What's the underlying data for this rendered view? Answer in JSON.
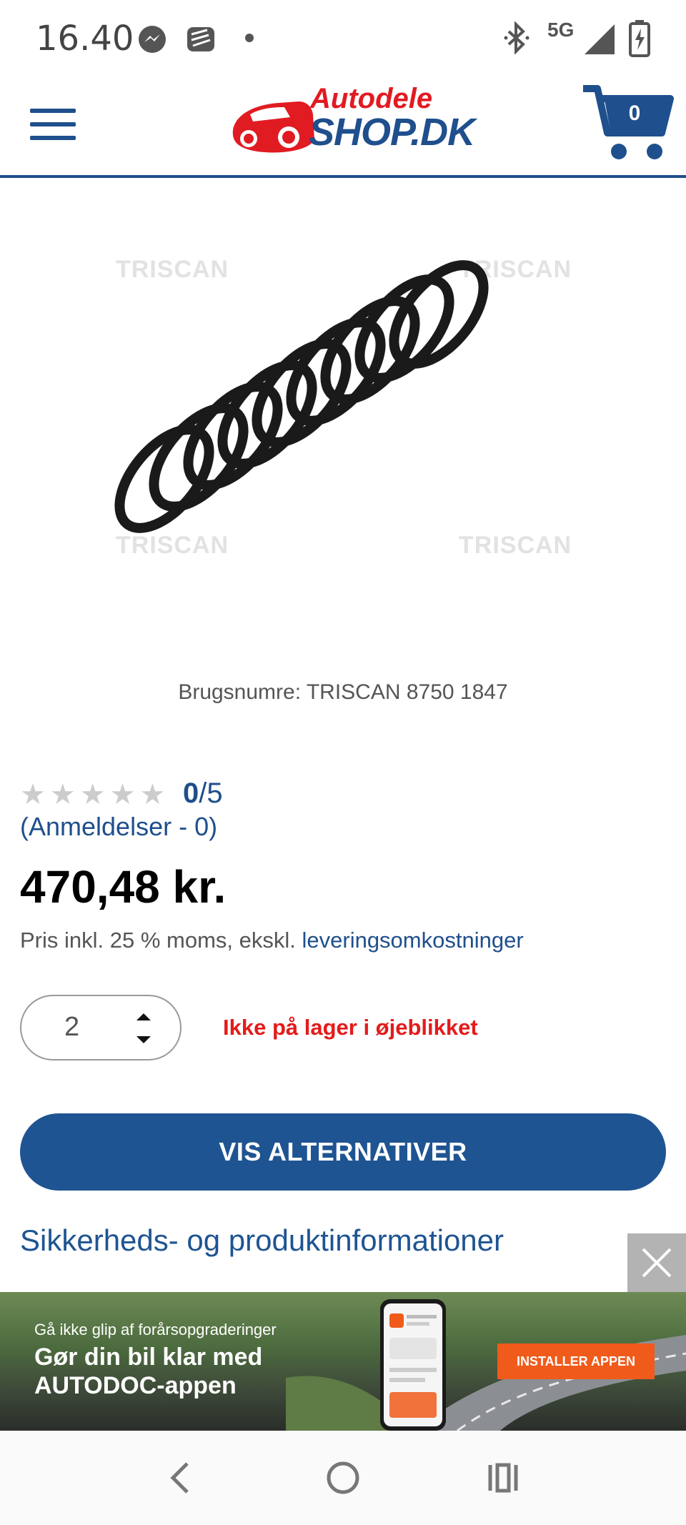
{
  "status_bar": {
    "time": "16.40",
    "network": "5G",
    "icons": [
      "messenger-icon",
      "stack-icon",
      "dot-icon",
      "bluetooth-icon",
      "signal-icon",
      "battery-icon"
    ]
  },
  "header": {
    "logo_top": "Autodele",
    "logo_bottom": "SHOP.DK",
    "cart_count": "0",
    "accent": "#1f4f8c"
  },
  "product": {
    "image_watermark": "TRISCAN",
    "usage_numbers": "Brugsnumre: TRISCAN 8750 1847",
    "rating_value": "0",
    "rating_max": "/5",
    "reviews_link": "(Anmeldelser - 0)",
    "price": "470,48 kr.",
    "price_note_prefix": "Pris inkl. 25 % moms, ekskl.",
    "price_note_link": "leveringsomkostninger",
    "quantity": "2",
    "stock_status": "Ikke på lager i øjeblikket",
    "stock_color": "#e31b1b",
    "alternatives_button": "VIS ALTERNATIVER",
    "safety_info_link": "Sikkerheds- og produktinformationer"
  },
  "ad": {
    "subtitle": "Gå ikke glip af forårsopgraderinger",
    "title_line1": "Gør din bil klar med",
    "title_line2": "AUTODOC-appen",
    "cta": "INSTALLER APPEN",
    "cta_color": "#f05a1a"
  },
  "nav": {
    "buttons": [
      "back-icon",
      "home-icon",
      "recents-icon"
    ]
  }
}
